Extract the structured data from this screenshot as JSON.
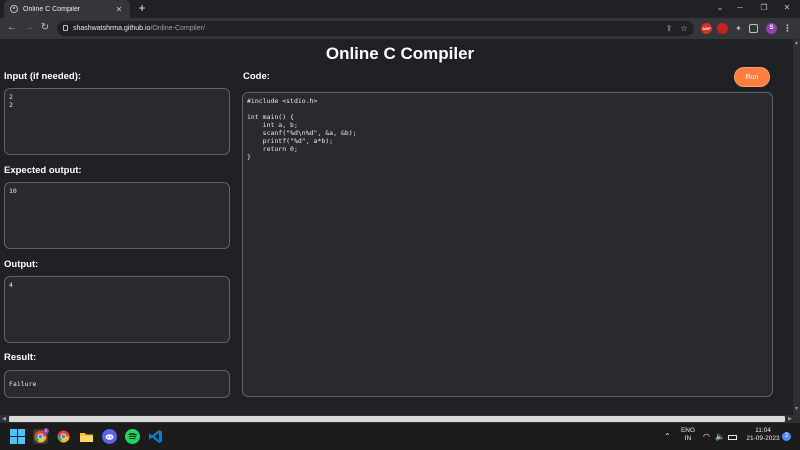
{
  "browser": {
    "tab_title": "Online C Compiler",
    "tab_close": "✕",
    "new_tab": "+",
    "url_host": "shashwatshrma.github.io",
    "url_path": "/Online-Compiler/",
    "profile_initial": "S",
    "abp_label": "ABP"
  },
  "page": {
    "title": "Online C Compiler",
    "input_label": "Input (if needed):",
    "input_value": "2\n2",
    "expected_label": "Expected output:",
    "expected_value": "10",
    "output_label": "Output:",
    "output_value": "4",
    "result_label": "Result:",
    "result_value": "Failure",
    "code_label": "Code:",
    "run_label": "Run",
    "code": "#include <stdio.h>\n\nint main() {\n    int a, b;\n    scanf(\"%d\\n%d\", &a, &b);\n    printf(\"%d\", a*b);\n    return 0;\n}"
  },
  "taskbar": {
    "lang_line1": "ENG",
    "lang_line2": "IN",
    "time": "11:04",
    "date": "21-09-2023",
    "notification_count": "2",
    "chrome_badge": "S"
  },
  "colors": {
    "accent": "#ff7f3f",
    "background": "#202124",
    "panel": "#292a2d"
  }
}
